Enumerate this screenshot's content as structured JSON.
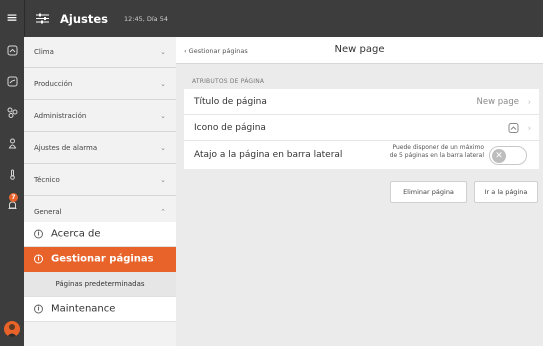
{
  "topbar": {
    "menu_icon": "hamburger-icon",
    "settings_icon": "sliders-icon",
    "title": "Ajustes",
    "status_time": "12:45, Día 54"
  },
  "rail": {
    "icons": [
      "home-icon",
      "dashboard-icon",
      "network-icon",
      "person-icon",
      "thermometer-icon",
      "bell-icon"
    ],
    "alarm_count": "7",
    "avatar": "avatar"
  },
  "sidebar": {
    "categories": [
      {
        "label": "Clima",
        "expanded": false
      },
      {
        "label": "Producción",
        "expanded": false
      },
      {
        "label": "Administración",
        "expanded": false
      },
      {
        "label": "Ajustes de alarma",
        "expanded": false
      },
      {
        "label": "Técnico",
        "expanded": false
      },
      {
        "label": "General",
        "expanded": true
      }
    ],
    "general_items": [
      {
        "label": "Acerca de",
        "active": false
      },
      {
        "label": "Gestionar páginas",
        "active": true
      },
      {
        "label": "Páginas predeterminadas",
        "nested": true
      },
      {
        "label": "Maintenance",
        "active": false
      }
    ],
    "chevron_down": "⌄",
    "chevron_up": "⌃"
  },
  "main": {
    "back_label": "‹ Gestionar páginas",
    "title": "New page",
    "section_title": "ATRIBUTOS DE PÁGINA",
    "rows": {
      "title_label": "Título de página",
      "title_value": "New page",
      "icon_label": "Icono de página",
      "icon_value": "home-icon",
      "sidebar_label": "Atajo a la página en barra lateral",
      "sidebar_note": "Puede disponer de un máximo de 5 páginas en la barra lateral",
      "sidebar_toggle_on": false
    },
    "buttons": {
      "delete": "Eliminar página",
      "goto": "Ir a la página"
    }
  },
  "colors": {
    "accent": "#e8632a",
    "dark": "#3d3d3d"
  }
}
